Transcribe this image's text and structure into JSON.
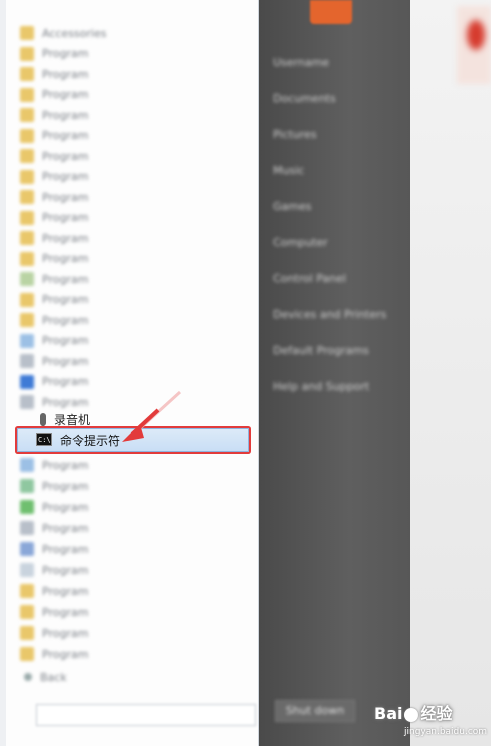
{
  "start_menu": {
    "programs": [
      {
        "label": "Accessories",
        "color": "#e9c76a"
      },
      {
        "label": "Program",
        "color": "#e9c76a"
      },
      {
        "label": "Program",
        "color": "#e9c76a"
      },
      {
        "label": "Program",
        "color": "#e9c76a"
      },
      {
        "label": "Program",
        "color": "#e9c76a"
      },
      {
        "label": "Program",
        "color": "#e9c76a"
      },
      {
        "label": "Program",
        "color": "#e9c76a"
      },
      {
        "label": "Program",
        "color": "#e9c76a"
      },
      {
        "label": "Program",
        "color": "#e9c76a"
      },
      {
        "label": "Program",
        "color": "#e9c76a"
      },
      {
        "label": "Program",
        "color": "#e9c76a"
      },
      {
        "label": "Program",
        "color": "#e9c76a"
      },
      {
        "label": "Program",
        "color": "#b9d3a4"
      },
      {
        "label": "Program",
        "color": "#e9c76a"
      },
      {
        "label": "Program",
        "color": "#e9c76a"
      },
      {
        "label": "Program",
        "color": "#9cc0e5"
      },
      {
        "label": "Program",
        "color": "#b8bfc9"
      },
      {
        "label": "Program",
        "color": "#3f7bd6"
      },
      {
        "label": "Program",
        "color": "#b8bfc9"
      }
    ],
    "recorder_label": "录音机",
    "cmd_label": "命令提示符",
    "cmd_icon_text": "C:\\",
    "programs_after": [
      {
        "label": "Program",
        "color": "#9cc0e5"
      },
      {
        "label": "Program",
        "color": "#8fc7a0"
      },
      {
        "label": "Program",
        "color": "#6fbf6f"
      },
      {
        "label": "Program",
        "color": "#b8bfc9"
      },
      {
        "label": "Program",
        "color": "#8aa7d8"
      },
      {
        "label": "Program",
        "color": "#c9d3de"
      },
      {
        "label": "Program",
        "color": "#e9c76a"
      },
      {
        "label": "Program",
        "color": "#e9c76a"
      },
      {
        "label": "Program",
        "color": "#e9c76a"
      },
      {
        "label": "Program",
        "color": "#e9c76a"
      }
    ],
    "back_label": "Back",
    "right_items": [
      "Username",
      "Documents",
      "Pictures",
      "Music",
      "Games",
      "Computer",
      "Control Panel",
      "Devices and Printers",
      "Default Programs",
      "Help and Support"
    ],
    "shutdown_label": "Shut down"
  },
  "watermark": {
    "brand": "Bai",
    "brand2": "经验",
    "site": "jingyan.baidu.com"
  },
  "colors": {
    "highlight": "#c9def5",
    "annotation": "#e23b3b"
  }
}
